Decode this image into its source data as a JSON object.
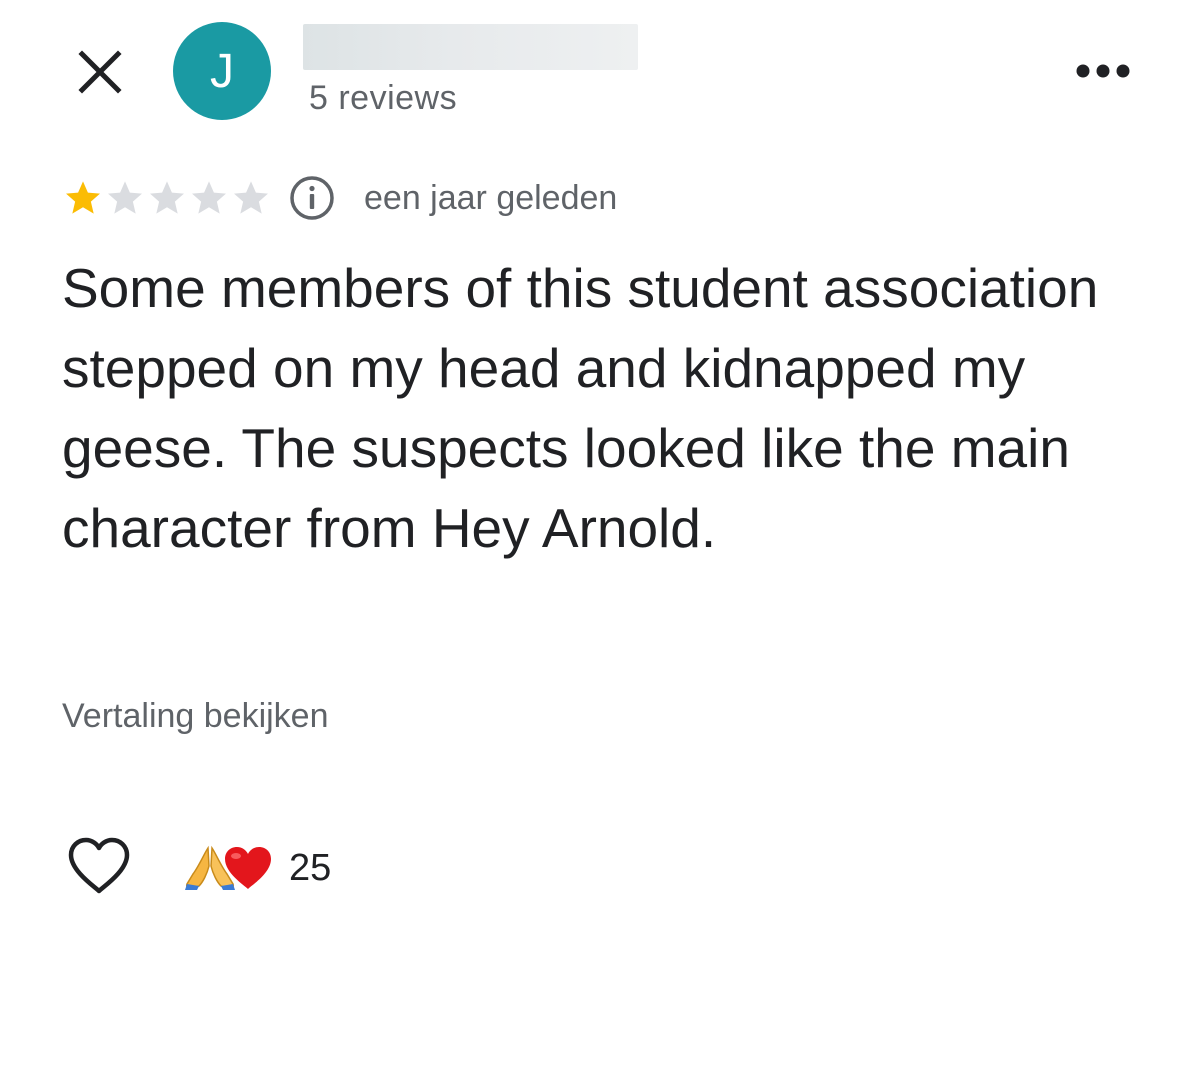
{
  "header": {
    "avatar_letter": "J",
    "review_count": "5 reviews"
  },
  "review": {
    "rating": 1,
    "rating_max": 5,
    "time_ago": "een jaar geleden",
    "text": "Some members of this student association stepped on my head and kidnapped my geese. The suspects looked like the main character from Hey Arnold.",
    "translate_label": "Vertaling bekijken"
  },
  "reactions": {
    "emojis": [
      "folded-hands-emoji",
      "red-heart-emoji"
    ],
    "count": "25"
  },
  "icons": {
    "close": "close-icon",
    "more": "more-options-icon",
    "info": "info-icon",
    "like": "heart-outline-icon"
  },
  "colors": {
    "avatar_bg": "#1a9aa3",
    "star_filled": "#fbbc04",
    "star_empty": "#dadce0",
    "text_primary": "#202124",
    "text_secondary": "#5f6368"
  }
}
